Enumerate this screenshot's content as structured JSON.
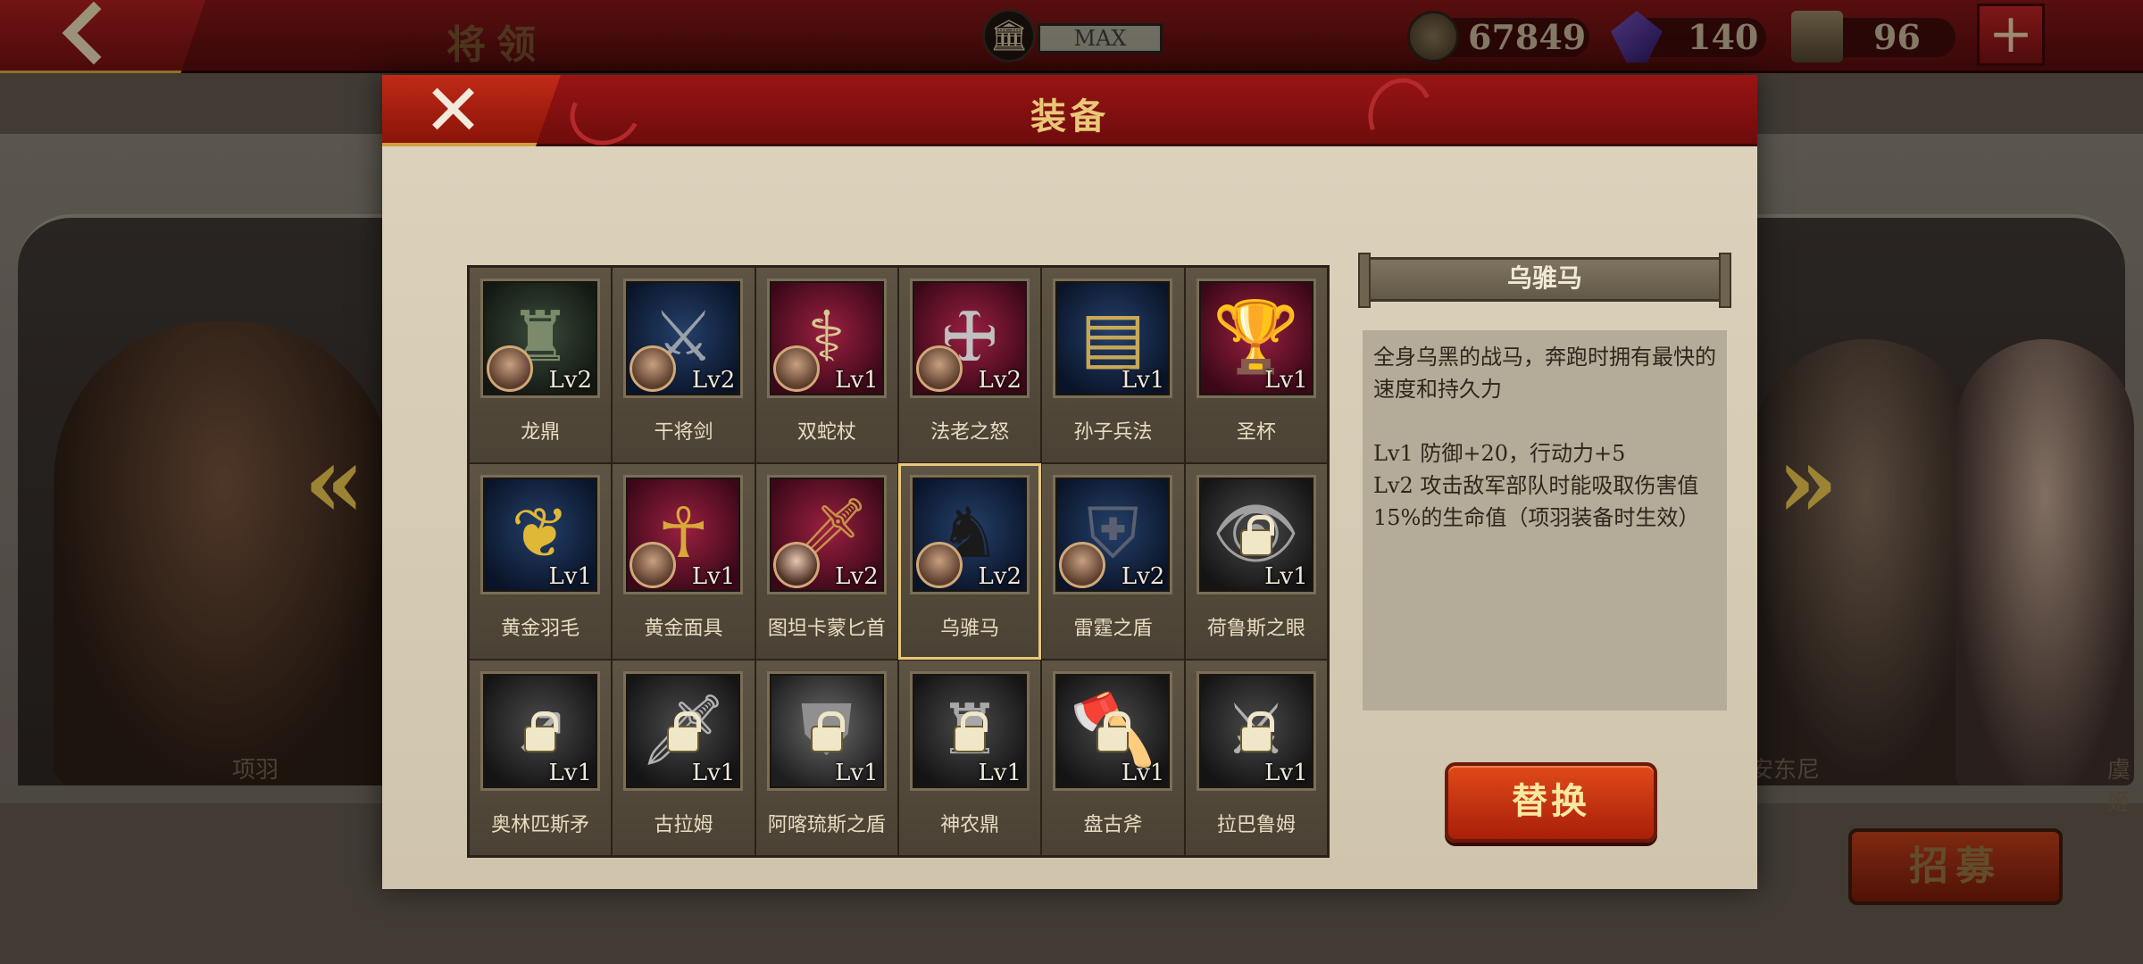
{
  "topbar": {
    "title": "将领",
    "max_label": "MAX",
    "gold": "67849",
    "gems": "140",
    "medals": "96"
  },
  "heroes": {
    "left_name": "项羽",
    "right_name_a": "安东尼",
    "right_name_b": "虞姬"
  },
  "recruit_label": "招募",
  "modal": {
    "title": "装备",
    "close_label": "✕"
  },
  "items": [
    {
      "name": "龙鼎",
      "level": "Lv2",
      "owner": true,
      "locked": false,
      "bg": "green",
      "glyph": "♜",
      "glyph_color": "#7a8a6a"
    },
    {
      "name": "干将剑",
      "level": "Lv2",
      "owner": true,
      "locked": false,
      "bg": "blue",
      "glyph": "⚔",
      "glyph_color": "#9aa0a8"
    },
    {
      "name": "双蛇杖",
      "level": "Lv1",
      "owner": true,
      "locked": false,
      "bg": "red",
      "glyph": "⚕",
      "glyph_color": "#d8c890"
    },
    {
      "name": "法老之怒",
      "level": "Lv2",
      "owner": true,
      "locked": false,
      "bg": "red",
      "glyph": "🜊",
      "glyph_color": "#c0c0c0"
    },
    {
      "name": "孙子兵法",
      "level": "Lv1",
      "owner": false,
      "locked": false,
      "bg": "blue",
      "glyph": "▤",
      "glyph_color": "#c8a858"
    },
    {
      "name": "圣杯",
      "level": "Lv1",
      "owner": false,
      "locked": false,
      "bg": "red",
      "glyph": "🏆",
      "glyph_color": "#e0b040"
    },
    {
      "name": "黄金羽毛",
      "level": "Lv1",
      "owner": false,
      "locked": false,
      "bg": "blue",
      "glyph": "❦",
      "glyph_color": "#e0b838"
    },
    {
      "name": "黄金面具",
      "level": "Lv1",
      "owner": true,
      "locked": false,
      "bg": "red",
      "glyph": "☥",
      "glyph_color": "#d8a838"
    },
    {
      "name": "图坦卡蒙匕首",
      "level": "Lv2",
      "owner": true,
      "locked": false,
      "bg": "red",
      "glyph": "🗡",
      "glyph_color": "#c89048",
      "female": true
    },
    {
      "name": "乌骓马",
      "level": "Lv2",
      "owner": true,
      "locked": false,
      "bg": "blue",
      "glyph": "♞",
      "glyph_color": "#1a1a1a",
      "selected": true
    },
    {
      "name": "雷霆之盾",
      "level": "Lv2",
      "owner": true,
      "locked": false,
      "bg": "blue",
      "glyph": "⛨",
      "glyph_color": "#5a6070"
    },
    {
      "name": "荷鲁斯之眼",
      "level": "Lv1",
      "owner": false,
      "locked": true,
      "bg": "dark",
      "glyph": "👁",
      "glyph_color": "#a0a0a0"
    },
    {
      "name": "奥林匹斯矛",
      "level": "Lv1",
      "owner": false,
      "locked": true,
      "bg": "dark",
      "glyph": "↗",
      "glyph_color": "#b0b0b0"
    },
    {
      "name": "古拉姆",
      "level": "Lv1",
      "owner": false,
      "locked": true,
      "bg": "dark",
      "glyph": "🗡",
      "glyph_color": "#b0b0b0"
    },
    {
      "name": "阿喀琉斯之盾",
      "level": "Lv1",
      "owner": false,
      "locked": true,
      "bg": "gray",
      "glyph": "⛊",
      "glyph_color": "#909090"
    },
    {
      "name": "神农鼎",
      "level": "Lv1",
      "owner": false,
      "locked": true,
      "bg": "dark",
      "glyph": "♜",
      "glyph_color": "#a8a8a8"
    },
    {
      "name": "盘古斧",
      "level": "Lv1",
      "owner": false,
      "locked": true,
      "bg": "dark",
      "glyph": "🪓",
      "glyph_color": "#b0b0b0"
    },
    {
      "name": "拉巴鲁姆",
      "level": "Lv1",
      "owner": false,
      "locked": true,
      "bg": "dark",
      "glyph": "⚔",
      "glyph_color": "#b0b0b0"
    }
  ],
  "detail": {
    "title": "乌骓马",
    "description": "全身乌黑的战马，奔跑时拥有最快的速度和持久力",
    "lv1": "Lv1  防御+20，行动力+5",
    "lv2": "Lv2  攻击敌军部队时能吸取伤害值15%的生命值（项羽装备时生效）",
    "replace_label": "替换"
  },
  "colors": {
    "header_red": "#8a1010",
    "gold_text": "#e8c878",
    "parchment": "#d6ccb4",
    "button_red": "#c83414"
  }
}
